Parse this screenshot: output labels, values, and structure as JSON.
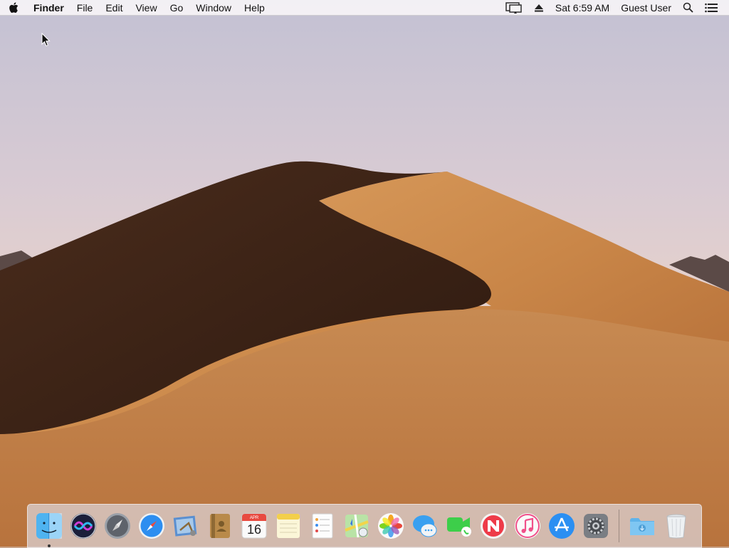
{
  "menubar": {
    "app_name": "Finder",
    "menus": [
      "File",
      "Edit",
      "View",
      "Go",
      "Window",
      "Help"
    ],
    "clock": "Sat 6:59 AM",
    "user": "Guest User",
    "status_icons": [
      "airplay-display-icon",
      "eject-icon",
      "spotlight-search-icon",
      "notification-center-icon"
    ]
  },
  "dock": {
    "apps": [
      {
        "name": "Finder",
        "icon": "finder-icon",
        "running": true
      },
      {
        "name": "Siri",
        "icon": "siri-icon"
      },
      {
        "name": "Launchpad",
        "icon": "launchpad-icon"
      },
      {
        "name": "Safari",
        "icon": "safari-icon"
      },
      {
        "name": "Mail",
        "icon": "mail-icon"
      },
      {
        "name": "Contacts",
        "icon": "contacts-icon"
      },
      {
        "name": "Calendar",
        "icon": "calendar-icon"
      },
      {
        "name": "Notes",
        "icon": "notes-icon"
      },
      {
        "name": "Reminders",
        "icon": "reminders-icon"
      },
      {
        "name": "Maps",
        "icon": "maps-icon"
      },
      {
        "name": "Photos",
        "icon": "photos-icon"
      },
      {
        "name": "Messages",
        "icon": "messages-icon"
      },
      {
        "name": "FaceTime",
        "icon": "facetime-icon"
      },
      {
        "name": "News",
        "icon": "news-icon"
      },
      {
        "name": "iTunes",
        "icon": "itunes-icon"
      },
      {
        "name": "App Store",
        "icon": "app-store-icon"
      },
      {
        "name": "System Preferences",
        "icon": "system-preferences-icon"
      }
    ],
    "calendar": {
      "month": "APR",
      "day": "16"
    },
    "stacks": [
      {
        "name": "Downloads",
        "icon": "downloads-folder-icon"
      },
      {
        "name": "Trash",
        "icon": "trash-icon"
      }
    ]
  },
  "colors": {
    "sky_top": "#c7c3d6",
    "sky_bottom": "#e6cfc7",
    "dune_light": "#c98a4b",
    "dune_shadow": "#3d2519",
    "menubar_bg": "#f6f4f6"
  }
}
